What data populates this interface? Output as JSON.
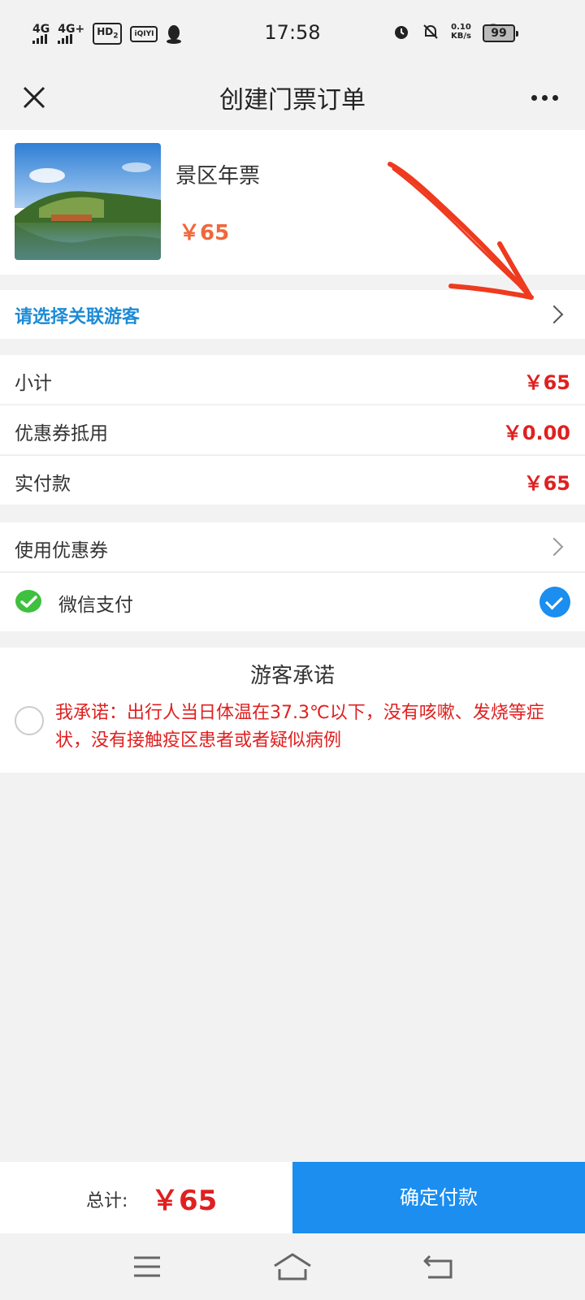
{
  "status_bar": {
    "network_1": "4G",
    "network_2": "4G+",
    "hd_badge": "HD",
    "hd_sub": "2",
    "app_badge": "iQIYI",
    "time": "17:58",
    "speed_value": "0.10",
    "speed_unit": "KB/s",
    "battery": "99"
  },
  "nav": {
    "title": "创建门票订单"
  },
  "product": {
    "name": "景区年票",
    "price": "￥65"
  },
  "visitor": {
    "label": "请选择关联游客"
  },
  "summary": {
    "subtotal_label": "小计",
    "subtotal_value": "￥65",
    "coupon_label": "优惠券抵用",
    "coupon_value": "￥0.00",
    "paid_label": "实付款",
    "paid_value": "￥65"
  },
  "payment": {
    "use_coupon_label": "使用优惠券",
    "wechat_label": "微信支付"
  },
  "promise": {
    "title": "游客承诺",
    "text": "我承诺：出行人当日体温在37.3℃以下，没有咳嗽、发烧等症状，没有接触疫区患者或者疑似病例"
  },
  "footer": {
    "total_label": "总计:",
    "total_value": "￥65",
    "pay_label": "确定付款"
  },
  "colors": {
    "accent_blue": "#1b8ef0",
    "price_red": "#e02020",
    "product_price_orange": "#f0673a",
    "link_blue": "#1c8bd6"
  }
}
